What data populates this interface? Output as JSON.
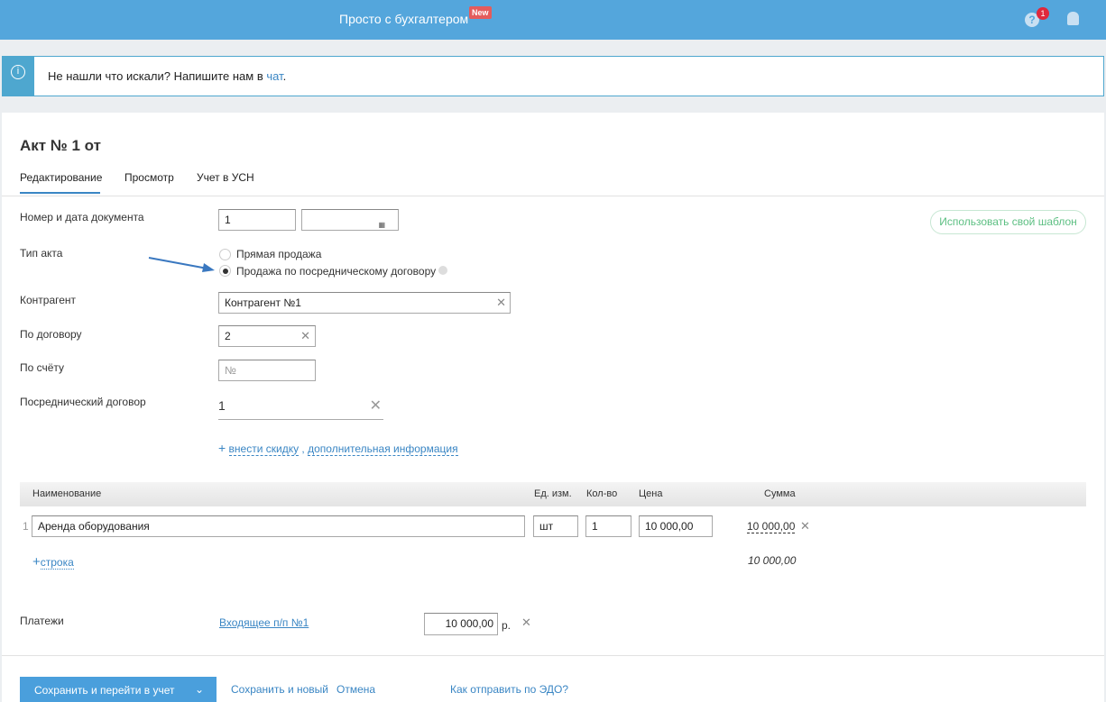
{
  "header": {
    "brand": "Просто с бухгалтером",
    "new_badge": "New",
    "help_count": "1",
    "help_icon": "?"
  },
  "info": {
    "text": "Не нашли что искали? Напишите нам в ",
    "link": "чат",
    "tail": "."
  },
  "doc": {
    "title": "Акт № 1 от",
    "tabs": [
      "Редактирование",
      "Просмотр",
      "Учет в УСН"
    ],
    "template_button": "Использовать свой шаблон"
  },
  "form": {
    "number_label": "Номер и дата документа",
    "number": "1",
    "date": "",
    "type_label": "Тип акта",
    "type_options": [
      "Прямая продажа",
      "Продажа по посредническому договору"
    ],
    "type_selected": 1,
    "counterparty_label": "Контрагент",
    "counterparty": "Контрагент №1",
    "contract_label": "По договору",
    "contract": "2",
    "invoice_label": "По счёту",
    "invoice_placeholder": "№",
    "agency_label": "Посреднический договор",
    "agency": "1",
    "extra_plus": "+",
    "extra_link1": "внести скидку",
    "extra_sep": " , ",
    "extra_link2": "дополнительная информация"
  },
  "table": {
    "headers": [
      "Наименование",
      "Ед. изм.",
      "Кол-во",
      "Цена",
      "Сумма"
    ],
    "rows": [
      {
        "n": "1",
        "name": "Аренда оборудования",
        "unit": "шт",
        "qty": "1",
        "price": "10 000,00",
        "sum": "10 000,00"
      }
    ],
    "add_plus": "+",
    "add_row": "строка",
    "total": "10 000,00"
  },
  "payments": {
    "label": "Платежи",
    "link": "Входящее п/п №1",
    "amount": "10 000,00",
    "currency": "р."
  },
  "footer": {
    "save": "Сохранить и перейти в учет",
    "save_new": "Сохранить и новый",
    "cancel": "Отмена",
    "edo": "Как отправить по ЭДО?"
  }
}
